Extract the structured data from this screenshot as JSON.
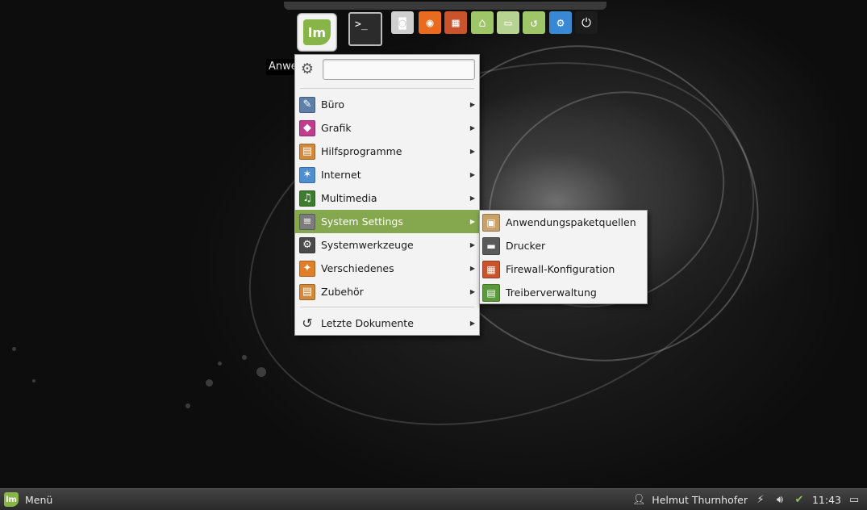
{
  "tooltip": "Anwe",
  "launchers": [
    {
      "icon": "terminal-icon",
      "glyph": ">_",
      "bg": "#2b2b2b"
    },
    {
      "icon": "screenshot-icon",
      "glyph": "◙",
      "bg": "#cfcfcf"
    },
    {
      "icon": "firefox-icon",
      "glyph": "◉",
      "bg": "#e96b1f"
    },
    {
      "icon": "firewall-icon",
      "glyph": "▦",
      "bg": "#c9532d"
    },
    {
      "icon": "home-folder-icon",
      "glyph": "⌂",
      "bg": "#9ec567"
    },
    {
      "icon": "folder-icon",
      "glyph": "▭",
      "bg": "#b6d392"
    },
    {
      "icon": "backup-folder-icon",
      "glyph": "↺",
      "bg": "#9ec567"
    },
    {
      "icon": "software-center-icon",
      "glyph": "⚙",
      "bg": "#3a88d4"
    },
    {
      "icon": "shutdown-icon",
      "glyph": "⏻",
      "bg": "#1c1c1c"
    }
  ],
  "menu": {
    "search": {
      "value": "",
      "placeholder": ""
    },
    "categories": [
      {
        "label": "Büro",
        "icon": "office-icon",
        "glyph": "✎",
        "color": "#5d7fa8",
        "active": false
      },
      {
        "label": "Grafik",
        "icon": "graphics-icon",
        "glyph": "◆",
        "color": "#c23b8c",
        "active": false
      },
      {
        "label": "Hilfsprogramme",
        "icon": "accessories-icon",
        "glyph": "▤",
        "color": "#d18a3c",
        "active": false
      },
      {
        "label": "Internet",
        "icon": "internet-icon",
        "glyph": "✶",
        "color": "#4f8fcf",
        "active": false
      },
      {
        "label": "Multimedia",
        "icon": "multimedia-icon",
        "glyph": "♫",
        "color": "#3d7d2e",
        "active": false
      },
      {
        "label": "System Settings",
        "icon": "system-settings-icon",
        "glyph": "≡",
        "color": "#7c7c7c",
        "active": true
      },
      {
        "label": "Systemwerkzeuge",
        "icon": "system-tools-icon",
        "glyph": "⚙",
        "color": "#4a4a4a",
        "active": false
      },
      {
        "label": "Verschiedenes",
        "icon": "other-icon",
        "glyph": "✦",
        "color": "#e07f2a",
        "active": false
      },
      {
        "label": "Zubehör",
        "icon": "utilities-icon",
        "glyph": "▤",
        "color": "#d18a3c",
        "active": false
      }
    ],
    "recent": {
      "label": "Letzte Dokumente",
      "icon": "recent-documents-icon",
      "glyph": "↺"
    }
  },
  "submenu": {
    "items": [
      {
        "label": "Anwendungspaketquellen",
        "icon": "software-sources-icon",
        "glyph": "▣",
        "color": "#c8a06a"
      },
      {
        "label": "Drucker",
        "icon": "printer-icon",
        "glyph": "▬",
        "color": "#5a5a5a"
      },
      {
        "label": "Firewall-Konfiguration",
        "icon": "firewall-config-icon",
        "glyph": "▦",
        "color": "#c9532d"
      },
      {
        "label": "Treiberverwaltung",
        "icon": "driver-manager-icon",
        "glyph": "▤",
        "color": "#5b9a3a"
      }
    ]
  },
  "taskbar": {
    "menu_label": "Menü",
    "logo_text": "lm",
    "user": "Helmut Thurnhofer",
    "clock": "11:43"
  }
}
